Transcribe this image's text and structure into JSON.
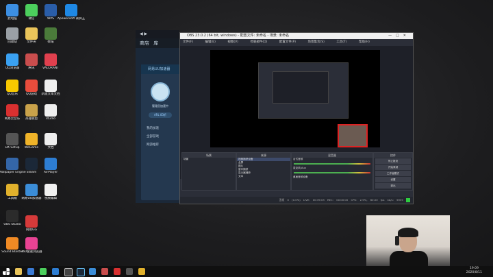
{
  "desktop_icons": [
    {
      "label": "此电脑",
      "color": "#3c8fe3"
    },
    {
      "label": "微信",
      "color": "#4ccf5d"
    },
    {
      "label": "WPS",
      "color": "#2a5da8"
    },
    {
      "label": "Apowersoft 录屏王",
      "color": "#1e88e5"
    },
    {
      "label": "回收站",
      "color": "#9aa0a6"
    },
    {
      "label": "文件夹",
      "color": "#e9c45a"
    },
    {
      "label": "壁纸",
      "color": "#4a7a3a"
    },
    {
      "label": "QQ浏览器",
      "color": "#3aa1f2"
    },
    {
      "label": "腾讯",
      "color": "#c94d4d"
    },
    {
      "label": "VALORANT",
      "color": "#e0404e"
    },
    {
      "label": "QQ音乐",
      "color": "#f7c800"
    },
    {
      "label": "QQ游戏",
      "color": "#e94c3c"
    },
    {
      "label": "新建文本文档",
      "color": "#eeeeee"
    },
    {
      "label": "网易云音乐",
      "color": "#d93030"
    },
    {
      "label": "英雄联盟",
      "color": "#c9a24a"
    },
    {
      "label": "studio",
      "color": "#eeeeee"
    },
    {
      "label": "DX Setup",
      "color": "#555555"
    },
    {
      "label": "WeGame",
      "color": "#f0b429"
    },
    {
      "label": "文档",
      "color": "#eeeeee"
    },
    {
      "label": "Wallpaper Engine",
      "color": "#3466a8"
    },
    {
      "label": "Steam",
      "color": "#1b2838"
    },
    {
      "label": "AirPlayer",
      "color": "#2d7dd2"
    },
    {
      "label": "工具箱",
      "color": "#e1b12c"
    },
    {
      "label": "网易UU加速器",
      "color": "#3b8dd8"
    },
    {
      "label": "视频编辑",
      "color": "#f0f0f0"
    },
    {
      "label": "OBS Studio",
      "color": "#2b2b2b"
    },
    {
      "label": "网易GG",
      "color": "#d63a3a"
    },
    {
      "label": "Sound Blaster",
      "color": "#f08a24"
    },
    {
      "label": "360极速浏览器",
      "color": "#e84393"
    }
  ],
  "steam": {
    "nav_store": "商店",
    "nav_library": "库",
    "panel_title": "网易UU加速器",
    "username": "管理员加速中",
    "pill_text": "ARL 83折",
    "menu": [
      "我的加速",
      "全部游戏",
      "网游推荐"
    ]
  },
  "obs": {
    "title": "OBS 23.0.2 (64 bit, windows) - 配置文件: 未命名 - 场景: 未命名",
    "menu": [
      "文件(F)",
      "编辑(E)",
      "视图(V)",
      "停靠部件(D)",
      "配置文件(P)",
      "场景集合(S)",
      "工具(T)",
      "帮助(H)"
    ],
    "docks": {
      "scenes": {
        "title": "场景",
        "items": [
          "场景"
        ]
      },
      "sources": {
        "title": "来源",
        "items": [
          "视频捕获设备",
          "全屏",
          "图片",
          "窗口捕获",
          "显示器捕获",
          "文本"
        ]
      },
      "mixer": {
        "title": "混音器",
        "items": [
          "台式音频",
          "麦克风/Aux",
          "桌面音频设备"
        ]
      },
      "controls": {
        "title": "控件",
        "items": [
          "停止推流",
          "开始录制",
          "工作室模式",
          "设置",
          "退出"
        ]
      },
      "extra_buttons": [
        "暂停",
        "退出编辑"
      ]
    },
    "status": [
      "丢帧 0 (0.0%)",
      "LIVE: 00:39:03",
      "REC: 00:00:00",
      "CPU: 2.9%, 60.00 fps",
      "kb/s: 5959"
    ]
  },
  "tray": {
    "time": "19:09",
    "date": "2020/8/11"
  }
}
